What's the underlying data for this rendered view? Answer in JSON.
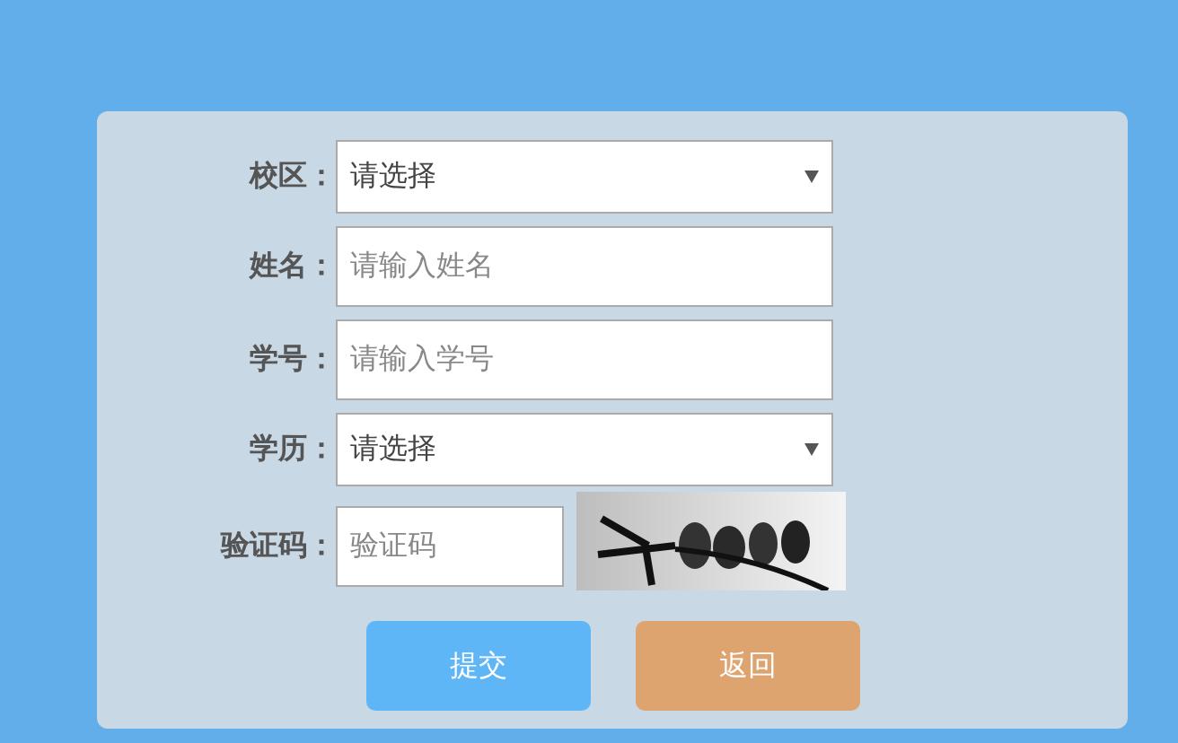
{
  "form": {
    "fields": [
      {
        "label": "校区：",
        "kind": "select",
        "value": "请选择"
      },
      {
        "label": "姓名：",
        "kind": "input",
        "placeholder": "请输入姓名"
      },
      {
        "label": "学号：",
        "kind": "input",
        "placeholder": "请输入学号"
      },
      {
        "label": "学历：",
        "kind": "select",
        "value": "请选择"
      },
      {
        "label": "验证码：",
        "kind": "captcha",
        "placeholder": "验证码"
      }
    ],
    "buttons": [
      {
        "label": "提交",
        "kind": "primary"
      },
      {
        "label": "返回",
        "kind": "secondary"
      }
    ]
  }
}
